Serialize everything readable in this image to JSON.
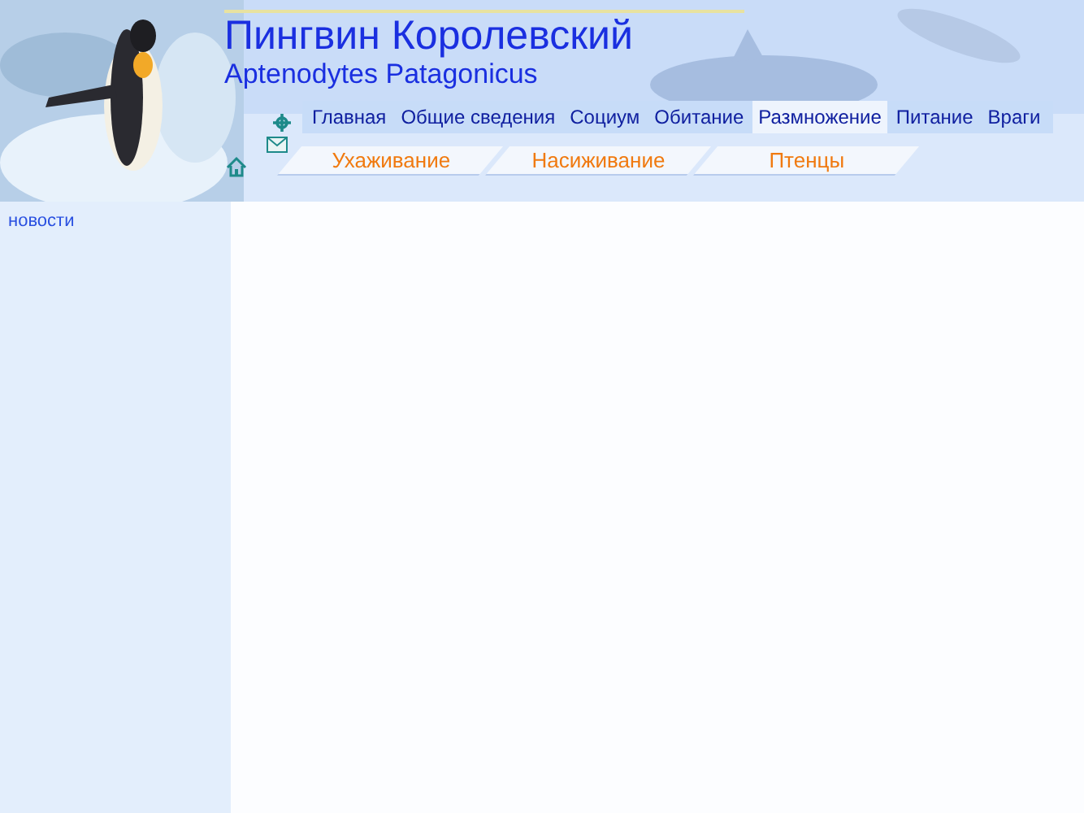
{
  "header": {
    "title": "Пингвин Королевский",
    "subtitle": "Aptenodytes Patagonicus"
  },
  "nav": [
    {
      "label": "Главная",
      "selected": false
    },
    {
      "label": "Общие сведения",
      "selected": false
    },
    {
      "label": "Социум",
      "selected": false
    },
    {
      "label": "Обитание",
      "selected": false
    },
    {
      "label": "Размножение",
      "selected": true
    },
    {
      "label": "Питание",
      "selected": false
    },
    {
      "label": "Враги",
      "selected": false
    }
  ],
  "subnav": [
    "Ухаживание",
    "Насиживание",
    "Птенцы"
  ],
  "sidebar": {
    "items": [
      "новости"
    ]
  }
}
